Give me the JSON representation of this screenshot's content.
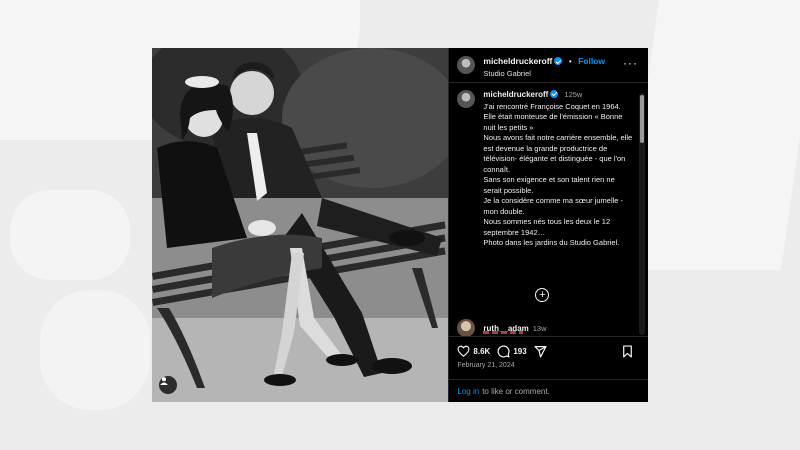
{
  "post": {
    "author": {
      "username": "micheldruckeroff",
      "verified": true,
      "follow_label": "Follow",
      "separator": "•",
      "location": "Studio Gabriel"
    },
    "more_icon": "more-horizontal-icon",
    "caption": {
      "username": "micheldruckeroff",
      "time_ago": "125w",
      "text": "J'ai rencontré Françoise Coquet en 1964.\nElle était monteuse de l'émission « Bonne nuit les petits »\nNous avons fait notre carrière ensemble, elle est devenue la grande productrice de télévision- élégante et distinguée -  que l'on connaît.\nSans son exigence et son talent rien ne serait possible.\nJe la  considère comme ma sœur jumelle - mon double.\nNous sommes nés tous les deux le 12 septembre 1942…\nPhoto dans les jardins du Studio Gabriel."
    },
    "load_more_icon": "plus-circle-icon",
    "reply": {
      "username": "ruth__adam",
      "time_ago": "13w"
    },
    "actions": {
      "likes": "8.6K",
      "comments": "193",
      "icons": [
        "heart-icon",
        "comment-icon",
        "share-icon",
        "bookmark-icon"
      ]
    },
    "date": "February 21, 2024",
    "login_prompt": {
      "link": "Log in",
      "text": "to like or comment."
    }
  },
  "colors": {
    "accent": "#0095f6",
    "panel_bg": "#000000",
    "muted_text": "#a8a8a8"
  }
}
